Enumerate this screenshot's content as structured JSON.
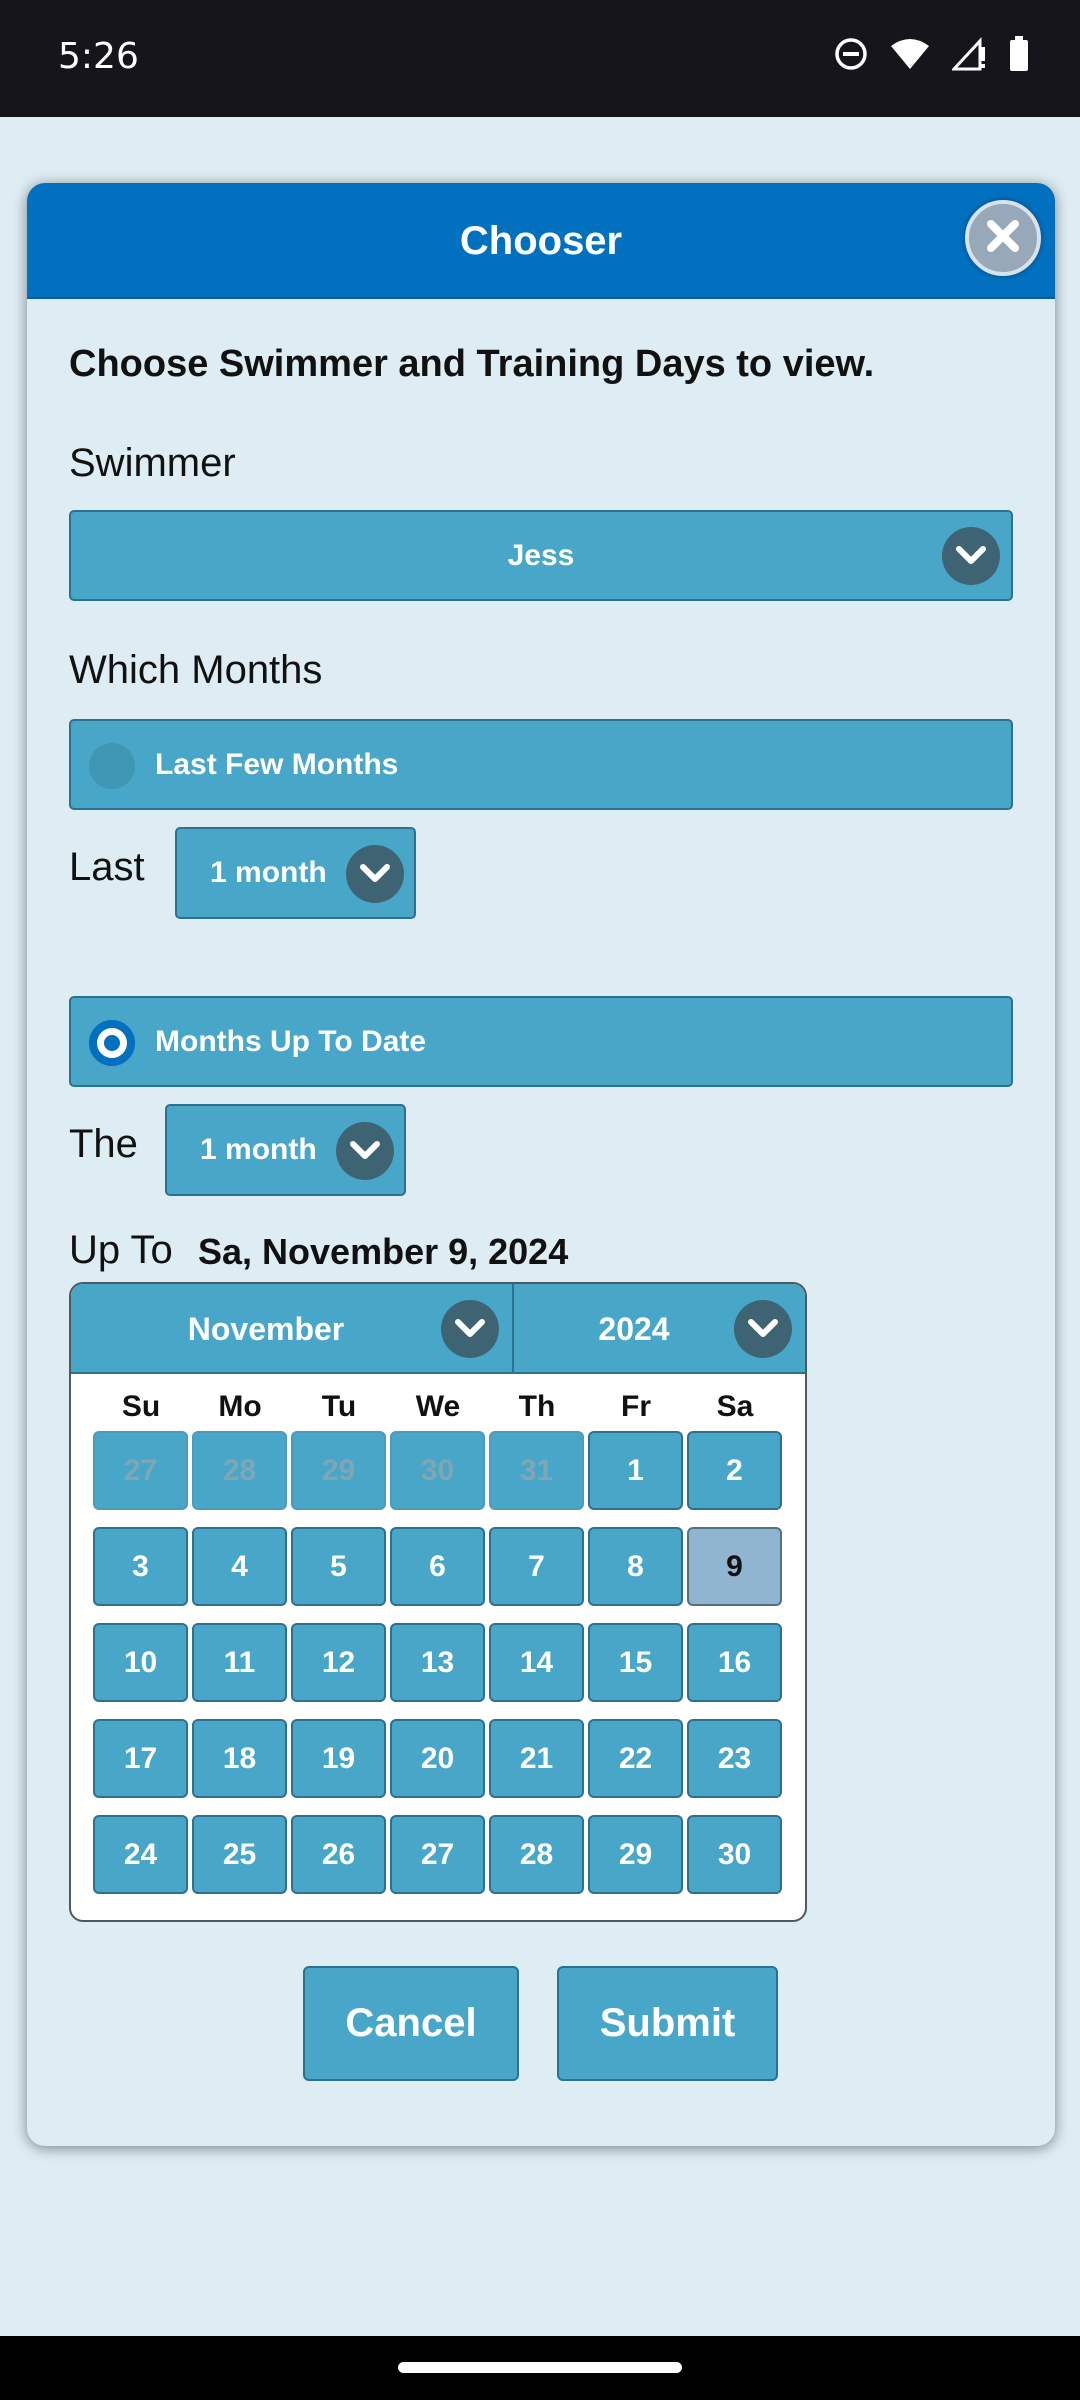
{
  "status_bar": {
    "time": "5:26",
    "icons": [
      "do-not-disturb-icon",
      "wifi-icon",
      "signal-icon",
      "battery-icon"
    ]
  },
  "dialog": {
    "title": "Chooser",
    "close_icon": "close-icon",
    "intro": "Choose Swimmer and Training Days to view.",
    "swimmer_label": "Swimmer",
    "swimmer_value": "Jess",
    "months_label": "Which Months",
    "option_last_few": {
      "label": "Last Few Months",
      "selected": false
    },
    "last_label": "Last",
    "last_value": "1 month",
    "option_up_to_date": {
      "label": "Months Up To Date",
      "selected": true
    },
    "the_label": "The",
    "the_value": "1 month",
    "upto_label": "Up To",
    "upto_date": "Sa, November 9, 2024",
    "calendar": {
      "month": "November",
      "year": "2024",
      "weekdays": [
        "Su",
        "Mo",
        "Tu",
        "We",
        "Th",
        "Fr",
        "Sa"
      ],
      "weeks": [
        [
          "27",
          "28",
          "29",
          "30",
          "31",
          "1",
          "2"
        ],
        [
          "3",
          "4",
          "5",
          "6",
          "7",
          "8",
          "9"
        ],
        [
          "10",
          "11",
          "12",
          "13",
          "14",
          "15",
          "16"
        ],
        [
          "17",
          "18",
          "19",
          "20",
          "21",
          "22",
          "23"
        ],
        [
          "24",
          "25",
          "26",
          "27",
          "28",
          "29",
          "30"
        ]
      ],
      "selected_day": "9"
    },
    "cancel_label": "Cancel",
    "submit_label": "Submit"
  },
  "colors": {
    "header": "#0070bf",
    "control": "#48a6c9",
    "background": "#ddedf3",
    "selected_day": "#8fb5d0"
  }
}
